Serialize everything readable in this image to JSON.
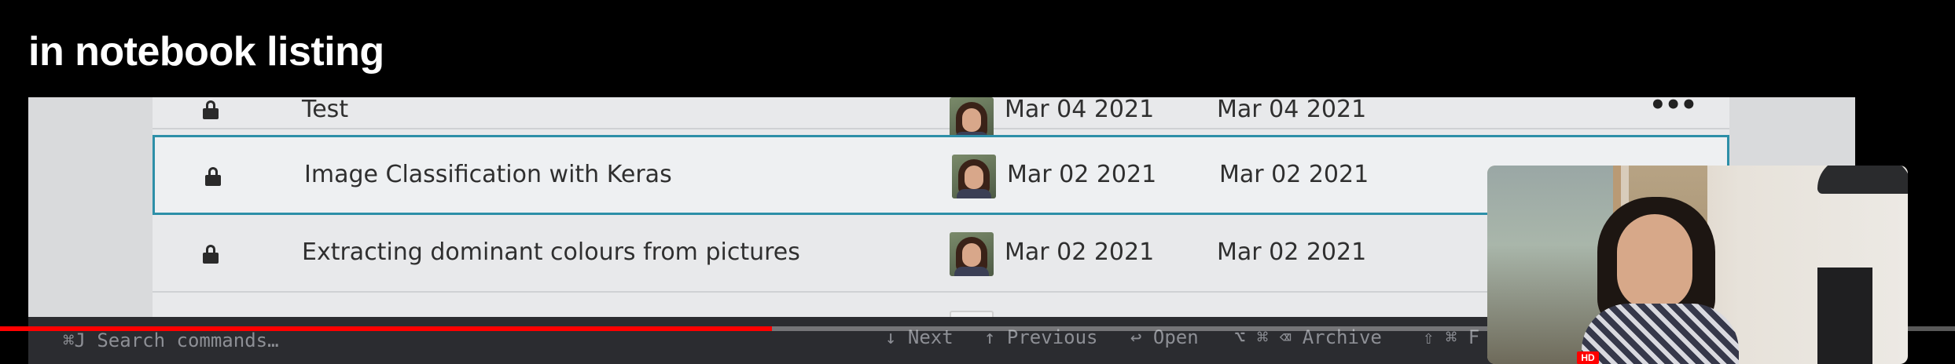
{
  "video": {
    "title": "in notebook listing",
    "progress": 0.395,
    "hd_badge": "HD",
    "accent": "#ff0000"
  },
  "notebooks": {
    "selected_border_color": "#2d8fa8",
    "rows": [
      {
        "name": "Test",
        "created": "Mar 04 2021",
        "modified": "Mar 04 2021",
        "selected": false
      },
      {
        "name": "Image Classification with Keras",
        "created": "Mar 02 2021",
        "modified": "Mar 02 2021",
        "selected": true
      },
      {
        "name": "Extracting dominant colours from pictures",
        "created": "Mar 02 2021",
        "modified": "Mar 02 2021",
        "selected": false
      }
    ],
    "more_icon": "more-horizontal-icon"
  },
  "command_bar": {
    "search_placeholder": "⌘J Search commands…",
    "next": "↓ Next",
    "previous": "↑ Previous",
    "open": "↩ Open",
    "archive": "⌥ ⌘ ⌫ Archive",
    "partial": "⇧ ⌘ F"
  }
}
